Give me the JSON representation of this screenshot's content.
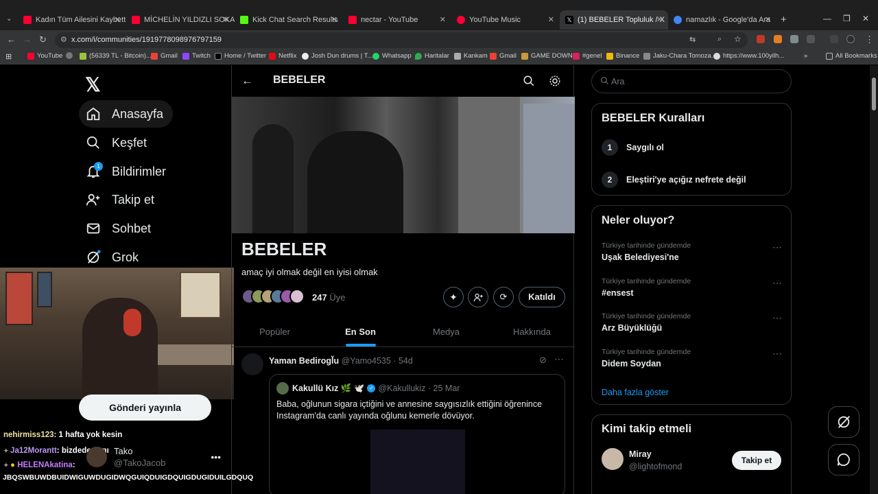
{
  "browser": {
    "tabs": [
      {
        "title": "Kadın Tüm Ailesini Kaybettiği X",
        "color": "#ff0033"
      },
      {
        "title": "MİCHELİN YILDIZLI SOKAK LEZZ",
        "color": "#ff0033"
      },
      {
        "title": "Kick Chat Search Results",
        "color": "#53fc18"
      },
      {
        "title": "nectar - YouTube",
        "color": "#ff0033"
      },
      {
        "title": "YouTube Music",
        "color": "#ff0033"
      },
      {
        "title": "(1) BEBELER Topluluk / X",
        "color": "#e7e9ea"
      },
      {
        "title": "namazlık - Google'da Ara",
        "color": "#4285f4"
      }
    ],
    "url": "x.com/i/communities/1919778098976797159",
    "bookmarks": [
      "YouTube",
      "(56339 TL - Bitcoin)...",
      "Gmail",
      "Twitch",
      "Home / Twitter",
      "Netflix",
      "Josh Dun drums | T...",
      "Whatsapp",
      "Haritalar",
      "Kankam",
      "Gmail",
      "GAME DOWN",
      "#genel",
      "Binance",
      "Jaku-Chara Tomoza...",
      "https://www.100yilh..."
    ],
    "all_bookmarks": "All Bookmarks"
  },
  "nav": {
    "items": [
      "Anasayfa",
      "Keşfet",
      "Bildirimler",
      "Takip et",
      "Sohbet",
      "Grok"
    ],
    "notif_count": "1",
    "post_button": "Gönderi yayınla",
    "profile_name": "Tako",
    "profile_handle": "@TakoJacob"
  },
  "chat": [
    {
      "user": "nehirmiss123",
      "text": ": 1 hafta yok kesin",
      "color": "#f0e3a0"
    },
    {
      "user": "Ja12Morantt",
      "text": ": bizdede aynı",
      "color": "#b89af0"
    },
    {
      "user": "HELENAkatina",
      "text": ":",
      "color": "#c77dff"
    }
  ],
  "chat_overflow": "JBQSWBUWDBUIDWIGUWDUGIDWQGUIQDUIGDQUIGDUGIDUILGDQUQ",
  "community": {
    "header_title": "BEBELER",
    "name": "BEBELER",
    "description": "amaç iyi olmak değil en iyisi olmak",
    "member_count": "247",
    "member_label": "Üye",
    "joined_label": "Katıldı",
    "tabs": [
      "Popüler",
      "En Son",
      "Medya",
      "Hakkında"
    ],
    "active_tab": "En Son"
  },
  "post": {
    "author": "Yaman Bedirogl̆u",
    "handle": "@Yamo4535 · 54d",
    "quote_author": "Kakullü Kız 🌿 🕊️",
    "quote_handle": "@Kakullukiz · 25 Mar",
    "quote_text": "Baba, oğlunun sigara içtiğini ve annesine saygısızlık ettiğini öğrenince Instagram'da canlı yayında oğlunu kemerle dövüyor."
  },
  "sidebar": {
    "search_placeholder": "Ara",
    "rules_title": "BEBELER Kuralları",
    "rules": [
      {
        "num": "1",
        "text": "Saygılı ol"
      },
      {
        "num": "2",
        "text": "Eleştiri'ye açığız nefrete değil"
      }
    ],
    "trends_title": "Neler oluyor?",
    "trends": [
      {
        "context": "Türkiye tarihinde gündemde",
        "name": "Uşak Belediyesi'ne"
      },
      {
        "context": "Türkiye tarihinde gündemde",
        "name": "#ensest"
      },
      {
        "context": "Türkiye tarihinde gündemde",
        "name": "Arz Büyüklüğü"
      },
      {
        "context": "Türkiye tarihinde gündemde",
        "name": "Didem Soydan"
      }
    ],
    "show_more": "Daha fazla göster",
    "follow_title": "Kimi takip etmeli",
    "follow_name": "Miray",
    "follow_handle": "@lightofmond",
    "follow_button": "Takip et"
  },
  "colors": {
    "accent": "#1d9bf0",
    "background": "#000000",
    "border": "#2f3336"
  }
}
